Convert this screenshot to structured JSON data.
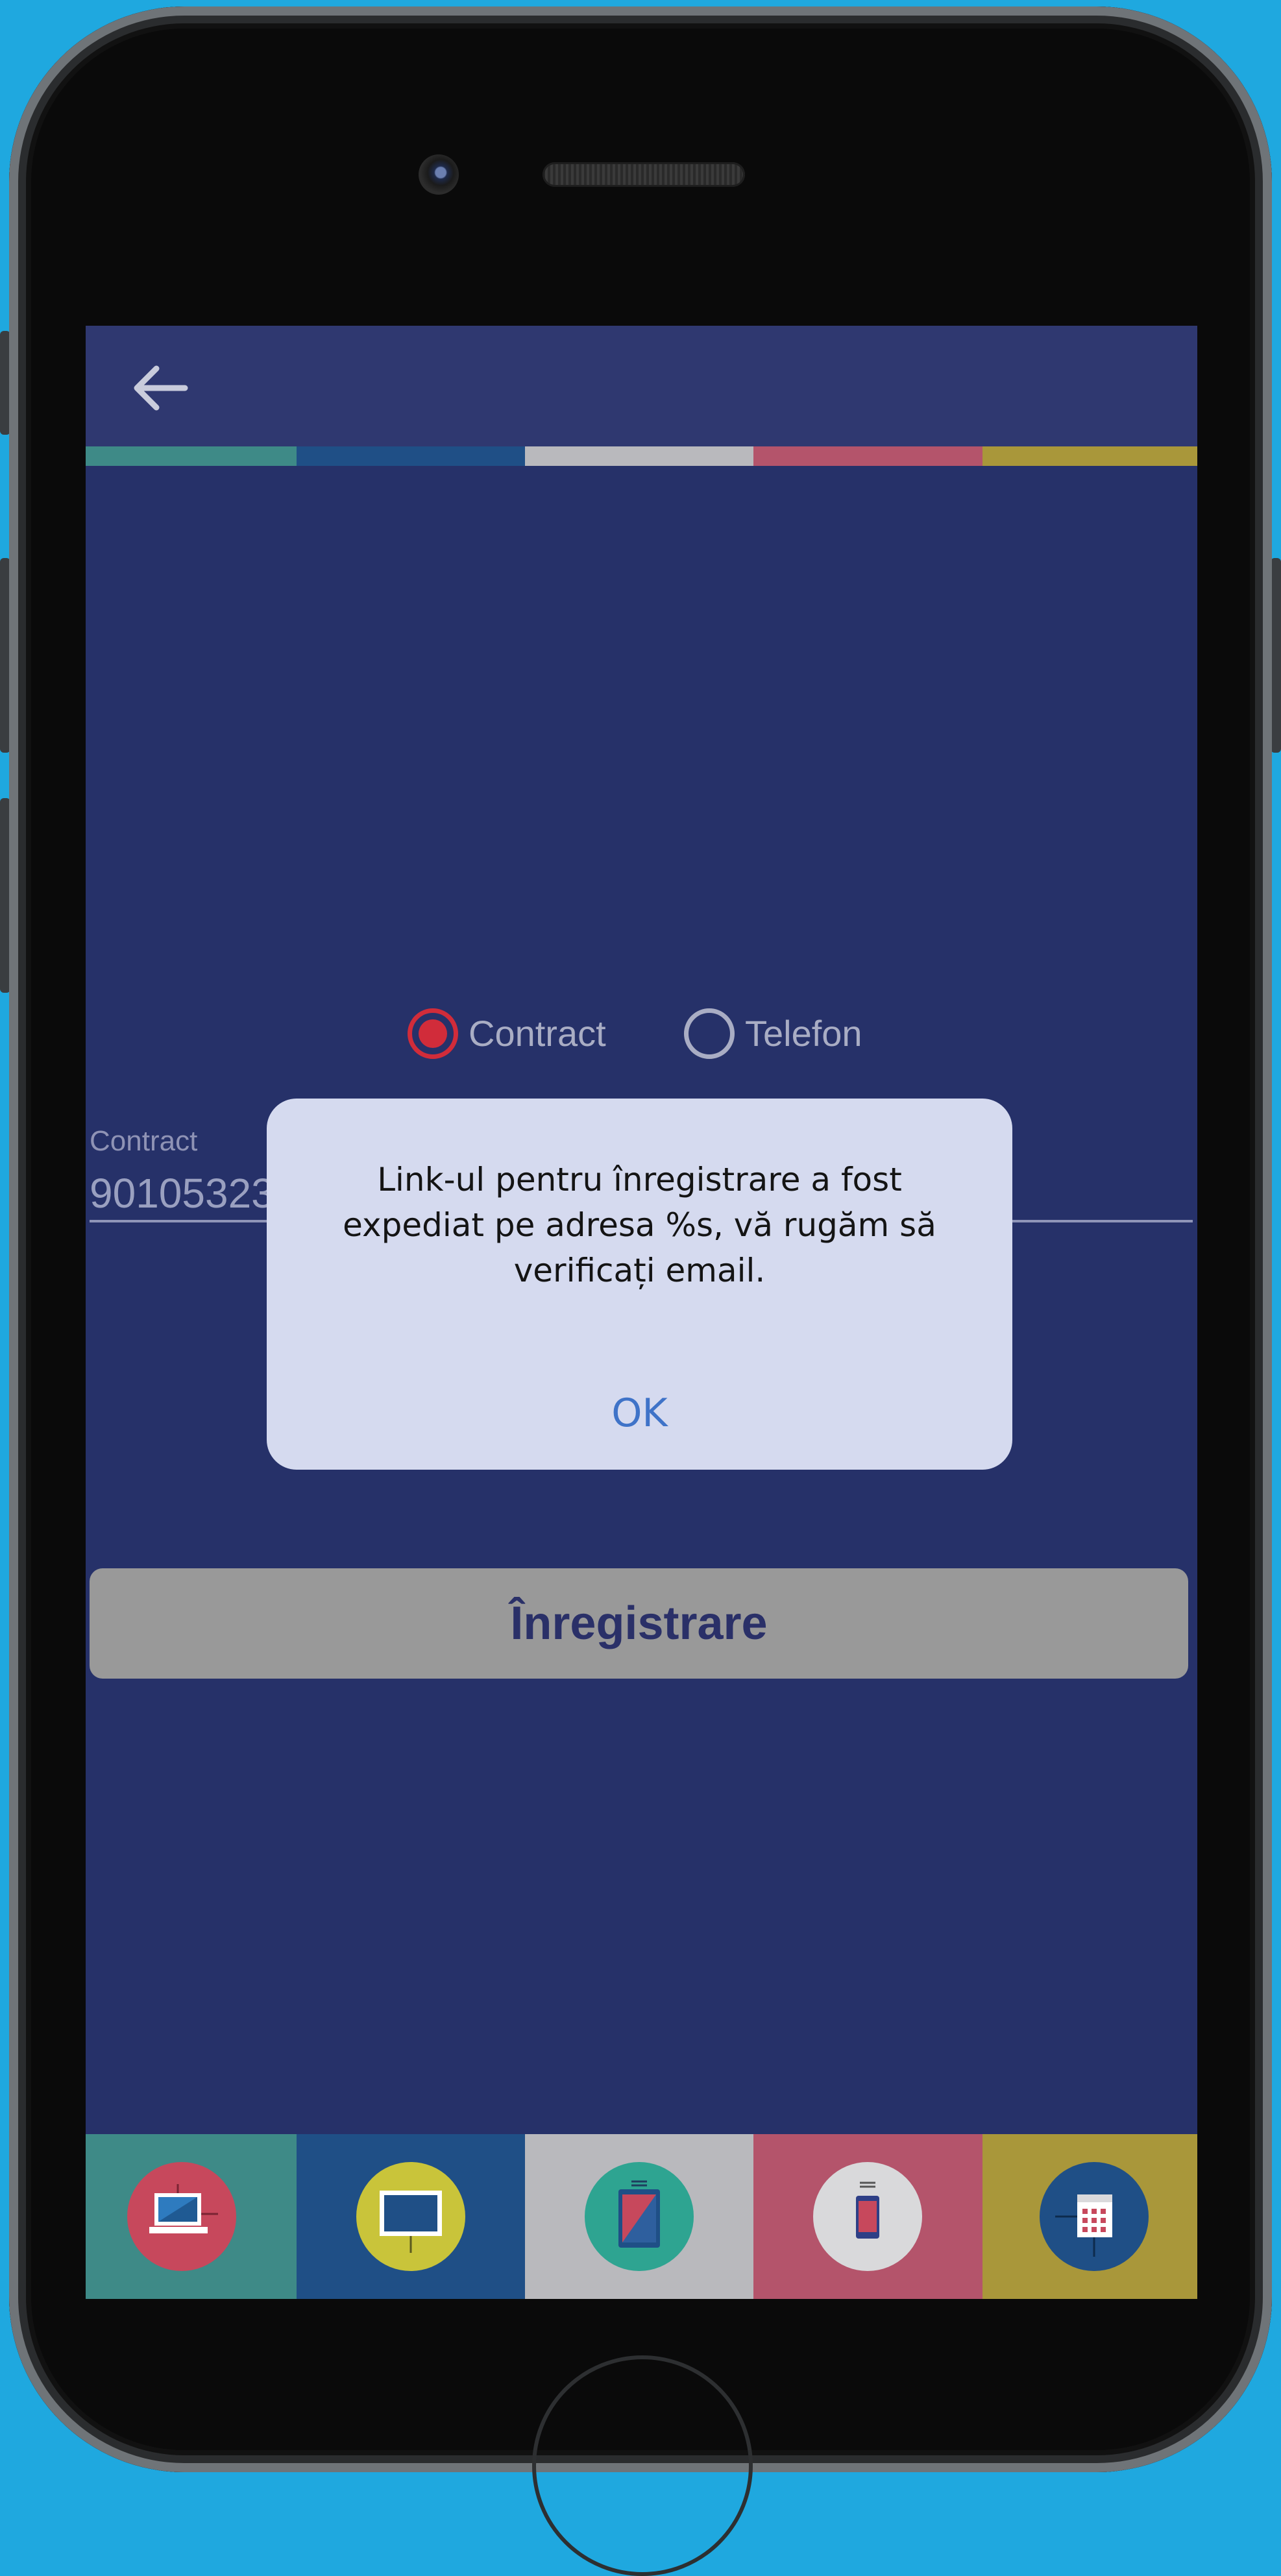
{
  "app_bar": {
    "back_icon": "arrow-left-icon"
  },
  "stripes": [
    "#3e8a87",
    "#1f4f86",
    "#b9b9bd",
    "#b4546b",
    "#a9973a"
  ],
  "login_type": {
    "options": [
      {
        "label": "Contract",
        "selected": true
      },
      {
        "label": "Telefon",
        "selected": false
      }
    ],
    "selected_color": "#d12c3a",
    "unselected_color": "#a9adc4"
  },
  "contract_field": {
    "label": "Contract",
    "value": "90105323"
  },
  "register_button": {
    "label": "Înregistrare"
  },
  "dialog": {
    "message": "Link-ul pentru înregistrare a fost expediat pe adresa %s, vă rugăm să verificați email.",
    "ok_label": "OK"
  },
  "tabbar": {
    "tabs": [
      {
        "icon": "laptop-icon",
        "background": "#3e8a87",
        "circle": "#c7485c"
      },
      {
        "icon": "monitor-icon",
        "background": "#1f4f86",
        "circle": "#c9c43a"
      },
      {
        "icon": "tablet-icon",
        "background": "#b9b9bd",
        "circle": "#2ea491"
      },
      {
        "icon": "phone-icon",
        "background": "#b4546b",
        "circle": "#d9d9db"
      },
      {
        "icon": "landline-phone-icon",
        "background": "#a9973a",
        "circle": "#1f4f86"
      }
    ]
  }
}
